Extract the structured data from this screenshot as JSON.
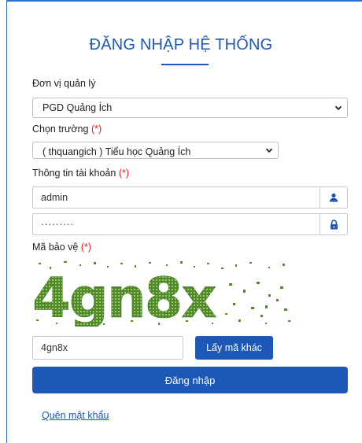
{
  "title": "ĐĂNG NHẬP HỆ THỐNG",
  "unit": {
    "label": "Đơn vị quản lý",
    "selected": "PGD Quảng Ích"
  },
  "school": {
    "label": "Chọn trường",
    "required_mark": "(*)",
    "selected": "( thquangich ) Tiểu học Quảng Ích"
  },
  "account": {
    "label": "Thông tin tài khoản",
    "required_mark": "(*)",
    "username": "admin",
    "password": "·········",
    "user_icon": "user-icon",
    "lock_icon": "lock-icon"
  },
  "captcha": {
    "label": "Mã bảo vệ",
    "required_mark": "(*)",
    "image_text": "4gn8x",
    "input_value": "4gn8x",
    "refresh_label": "Lấy mã khác"
  },
  "login_button": "Đăng nhập",
  "forgot_link": "Quên mật khẩu",
  "colors": {
    "primary": "#1d57b8",
    "required": "#e0241b",
    "captcha_green": "#3f7a1e"
  }
}
